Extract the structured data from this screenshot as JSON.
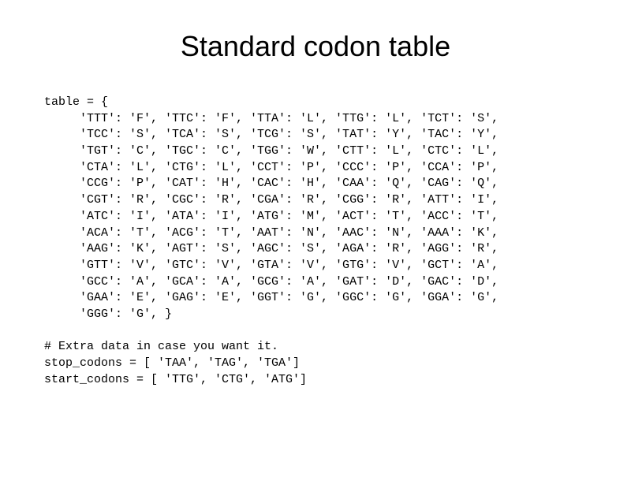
{
  "title": "Standard codon table",
  "code_lines": {
    "l0": "table = {",
    "l1": "     'TTT': 'F', 'TTC': 'F', 'TTA': 'L', 'TTG': 'L', 'TCT': 'S',",
    "l2": "     'TCC': 'S', 'TCA': 'S', 'TCG': 'S', 'TAT': 'Y', 'TAC': 'Y',",
    "l3": "     'TGT': 'C', 'TGC': 'C', 'TGG': 'W', 'CTT': 'L', 'CTC': 'L',",
    "l4": "     'CTA': 'L', 'CTG': 'L', 'CCT': 'P', 'CCC': 'P', 'CCA': 'P',",
    "l5": "     'CCG': 'P', 'CAT': 'H', 'CAC': 'H', 'CAA': 'Q', 'CAG': 'Q',",
    "l6": "     'CGT': 'R', 'CGC': 'R', 'CGA': 'R', 'CGG': 'R', 'ATT': 'I',",
    "l7": "     'ATC': 'I', 'ATA': 'I', 'ATG': 'M', 'ACT': 'T', 'ACC': 'T',",
    "l8": "     'ACA': 'T', 'ACG': 'T', 'AAT': 'N', 'AAC': 'N', 'AAA': 'K',",
    "l9": "     'AAG': 'K', 'AGT': 'S', 'AGC': 'S', 'AGA': 'R', 'AGG': 'R',",
    "l10": "     'GTT': 'V', 'GTC': 'V', 'GTA': 'V', 'GTG': 'V', 'GCT': 'A',",
    "l11": "     'GCC': 'A', 'GCA': 'A', 'GCG': 'A', 'GAT': 'D', 'GAC': 'D',",
    "l12": "     'GAA': 'E', 'GAG': 'E', 'GGT': 'G', 'GGC': 'G', 'GGA': 'G',",
    "l13": "     'GGG': 'G', }",
    "blank": "",
    "c0": "# Extra data in case you want it.",
    "c1": "stop_codons = [ 'TAA', 'TAG', 'TGA']",
    "c2": "start_codons = [ 'TTG', 'CTG', 'ATG']"
  }
}
